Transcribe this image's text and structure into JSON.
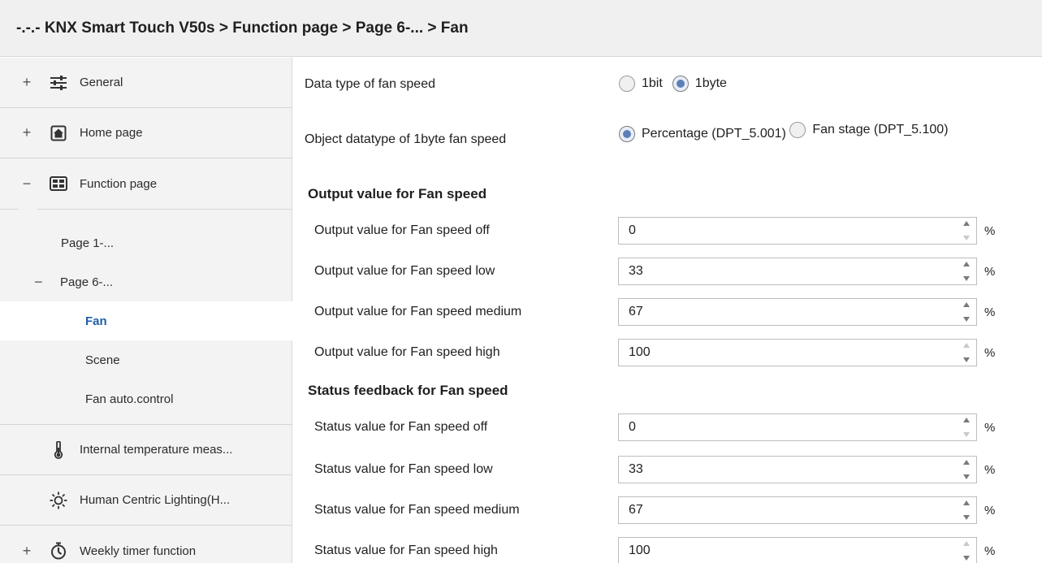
{
  "title": "-.-.- KNX Smart Touch V50s > Function page > Page 6-... > Fan",
  "sidebar": {
    "items": [
      {
        "expander": "+",
        "icon": "sliders-icon",
        "label": "General"
      },
      {
        "expander": "+",
        "icon": "home-icon",
        "label": "Home page"
      },
      {
        "expander": "−",
        "icon": "grid-icon",
        "label": "Function page"
      }
    ],
    "subitems": [
      {
        "expander": "",
        "label": "Page 1-..."
      },
      {
        "expander": "−",
        "label": "Page 6-..."
      },
      {
        "label": "Fan",
        "active": true
      },
      {
        "label": "Scene"
      },
      {
        "label": "Fan auto.control"
      }
    ],
    "lower_items": [
      {
        "expander": "",
        "icon": "thermometer-icon",
        "label": "Internal temperature meas..."
      },
      {
        "expander": "",
        "icon": "sun-icon",
        "label": "Human Centric Lighting(H..."
      },
      {
        "expander": "+",
        "icon": "timer-icon",
        "label": "Weekly timer function"
      }
    ]
  },
  "main": {
    "data_type": {
      "label": "Data type of fan speed",
      "options": [
        "1bit",
        "1byte"
      ],
      "selected": "1byte"
    },
    "object_datatype": {
      "label": "Object datatype of 1byte fan speed",
      "options": [
        "Percentage (DPT_5.001)",
        "Fan stage (DPT_5.100)"
      ],
      "selected": "Percentage (DPT_5.001)"
    },
    "output_section": {
      "title": "Output value for Fan speed",
      "rows": [
        {
          "label": "Output value for Fan speed off",
          "value": "0",
          "unit": "%"
        },
        {
          "label": "Output value for Fan speed low",
          "value": "33",
          "unit": "%"
        },
        {
          "label": "Output value for Fan speed medium",
          "value": "67",
          "unit": "%"
        },
        {
          "label": "Output value for Fan speed high",
          "value": "100",
          "unit": "%"
        }
      ]
    },
    "status_section": {
      "title": "Status feedback for Fan speed",
      "rows": [
        {
          "label": "Status value for Fan speed off",
          "value": "0",
          "unit": "%"
        },
        {
          "label": "Status value for Fan speed low",
          "value": "33",
          "unit": "%"
        },
        {
          "label": "Status value for Fan speed medium",
          "value": "67",
          "unit": "%"
        },
        {
          "label": "Status value for Fan speed high",
          "value": "100",
          "unit": "%"
        }
      ]
    }
  },
  "colors": {
    "active_text": "#1e5fa8",
    "sidebar_bg": "#f3f3f3",
    "radio_dot": "#5b7fb5"
  }
}
